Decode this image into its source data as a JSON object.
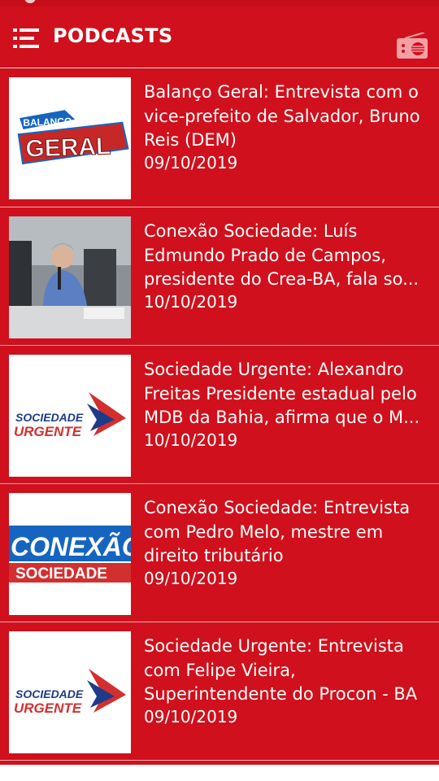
{
  "app": {
    "title": "PODCASTS",
    "menu_icon": "menu-list-icon",
    "radio_icon": "radio-icon",
    "colors": {
      "primary": "#d0101c",
      "text": "#ffffff",
      "divider": "#e8aeb1"
    }
  },
  "podcasts": [
    {
      "title": "Balanço Geral: Entrevista com o vice-prefeito de Salvador, Bruno Reis (DEM)",
      "date": "09/10/2019",
      "thumb": "balanco-geral-logo",
      "logo_top": "BALANÇO",
      "logo_bottom": "GERAL"
    },
    {
      "title": "Conexão Sociedade: Luís Edmundo Prado de Campos, presidente do Crea-BA, fala so...",
      "date": "10/10/2019",
      "thumb": "studio-photo"
    },
    {
      "title": "Sociedade Urgente: Alexandro Freitas Presidente estadual pelo MDB da Bahia, afirma que o M...",
      "date": "10/10/2019",
      "thumb": "sociedade-urgente-logo",
      "logo_top": "SOCIEDADE",
      "logo_bottom": "URGENTE"
    },
    {
      "title": "Conexão Sociedade: Entrevista com Pedro Melo, mestre em direito tributário",
      "date": "09/10/2019",
      "thumb": "conexao-sociedade-logo",
      "logo_top": "CONEXÃO",
      "logo_bottom": "SOCIEDADE"
    },
    {
      "title": "Sociedade Urgente: Entrevista com Felipe Vieira, Superintendente do Procon - BA",
      "date": "09/10/2019",
      "thumb": "sociedade-urgente-logo",
      "logo_top": "SOCIEDADE",
      "logo_bottom": "URGENTE"
    }
  ]
}
